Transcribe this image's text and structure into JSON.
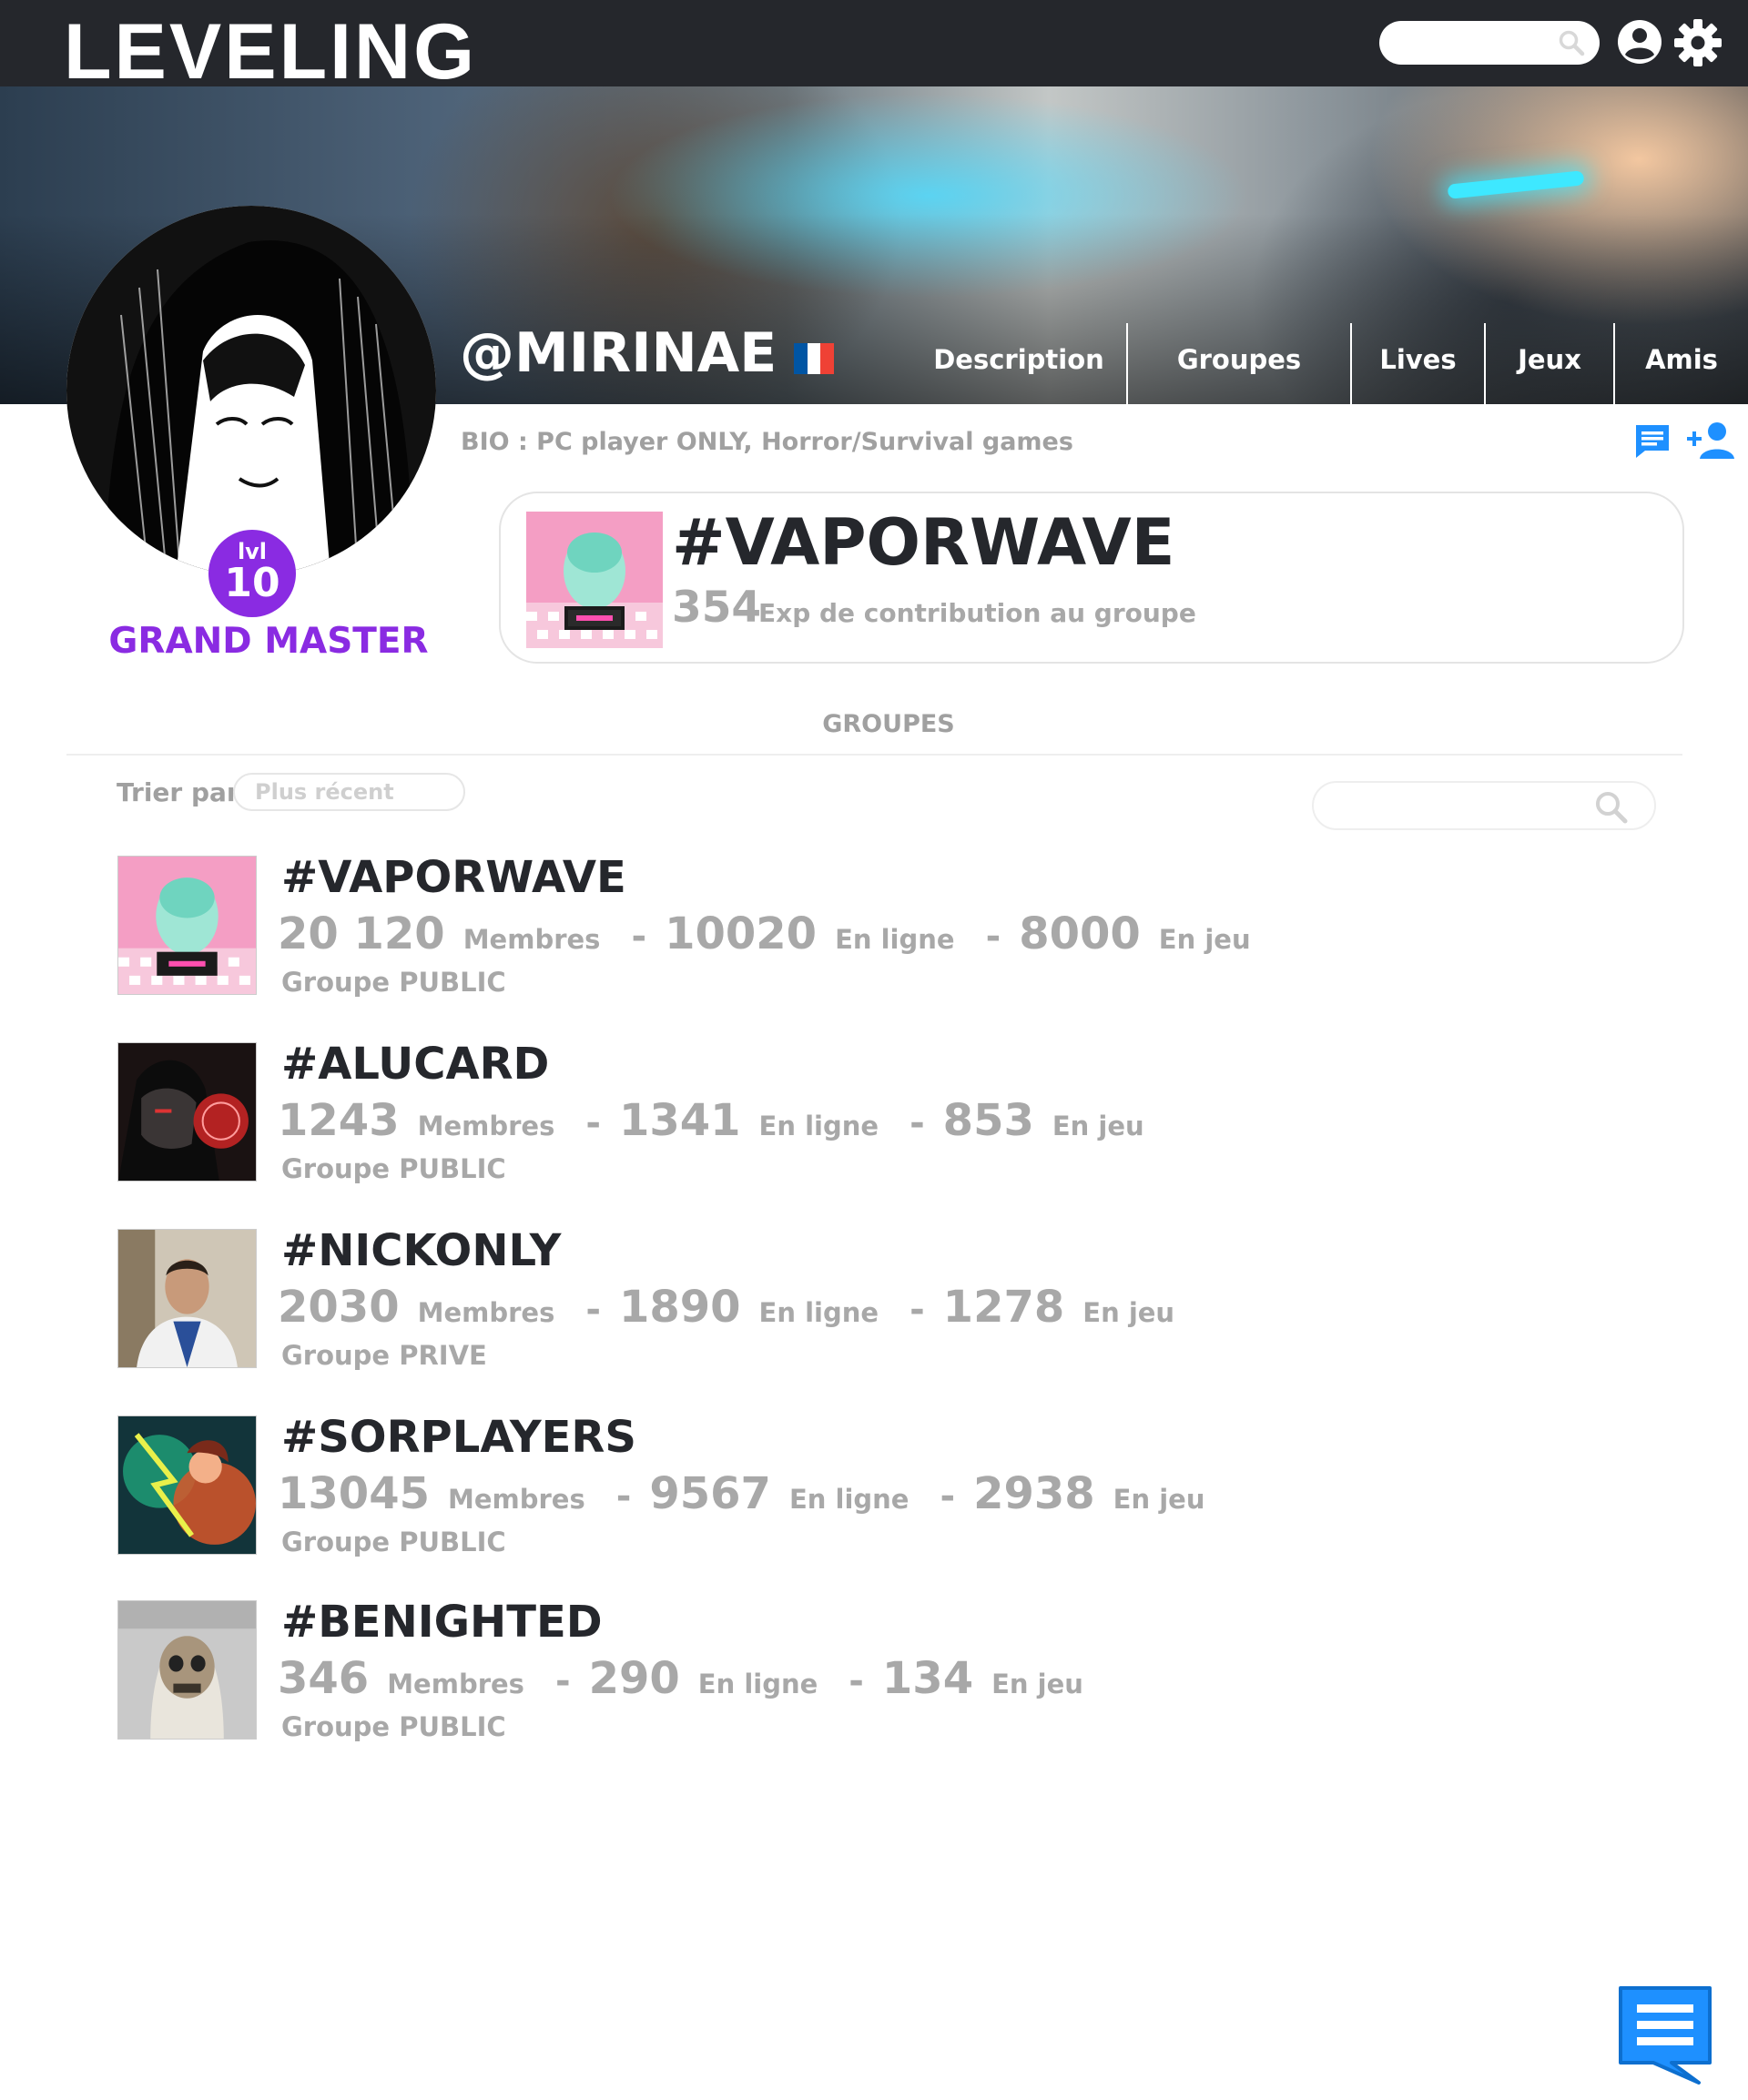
{
  "app": {
    "logo": "LEVELING",
    "search_placeholder": ""
  },
  "profile": {
    "username": "@MIRINAE",
    "bio": "BIO : PC player ONLY, Horror/Survival games",
    "level_prefix": "lvl",
    "level": "10",
    "rank": "GRAND MASTER",
    "flag": "france-flag"
  },
  "nav": {
    "items": [
      {
        "label": "Description"
      },
      {
        "label": "Groupes"
      },
      {
        "label": "Lives"
      },
      {
        "label": "Jeux"
      },
      {
        "label": "Amis"
      }
    ]
  },
  "featured_group": {
    "name": "#VAPORWAVE",
    "exp": "354",
    "exp_label": "Exp de contribution au groupe"
  },
  "section": {
    "title": "GROUPES",
    "sort_label": "Trier par",
    "sort_value": "Plus récent",
    "search_placeholder": ""
  },
  "groups": [
    {
      "name": "#VAPORWAVE",
      "members": "20 120",
      "members_label": "Membres",
      "online": "10020",
      "online_label": "En ligne",
      "ingame": "8000",
      "ingame_label": "En jeu",
      "type": "Groupe PUBLIC"
    },
    {
      "name": "#ALUCARD",
      "members": "1243",
      "members_label": "Membres",
      "online": "1341",
      "online_label": "En ligne",
      "ingame": "853",
      "ingame_label": "En jeu",
      "type": "Groupe PUBLIC"
    },
    {
      "name": "#NICKONLY",
      "members": "2030",
      "members_label": "Membres",
      "online": "1890",
      "online_label": "En ligne",
      "ingame": "1278",
      "ingame_label": "En jeu",
      "type": "Groupe PRIVE"
    },
    {
      "name": "#SORPLAYERS",
      "members": "13045",
      "members_label": "Membres",
      "online": "9567",
      "online_label": "En ligne",
      "ingame": "2938",
      "ingame_label": "En jeu",
      "type": "Groupe PUBLIC"
    },
    {
      "name": "#BENIGHTED",
      "members": "346",
      "members_label": "Membres",
      "online": "290",
      "online_label": "En ligne",
      "ingame": "134",
      "ingame_label": "En jeu",
      "type": "Groupe PUBLIC"
    }
  ],
  "icons": {
    "search": "search-icon",
    "user": "user-circle-icon",
    "settings": "gear-icon",
    "message": "message-icon",
    "add_friend": "add-friend-icon",
    "chat": "chat-icon"
  },
  "colors": {
    "topbar": "#25272c",
    "accent_purple": "#8a2be2",
    "accent_blue": "#1e90ff",
    "muted_text": "#a8a8a8"
  }
}
